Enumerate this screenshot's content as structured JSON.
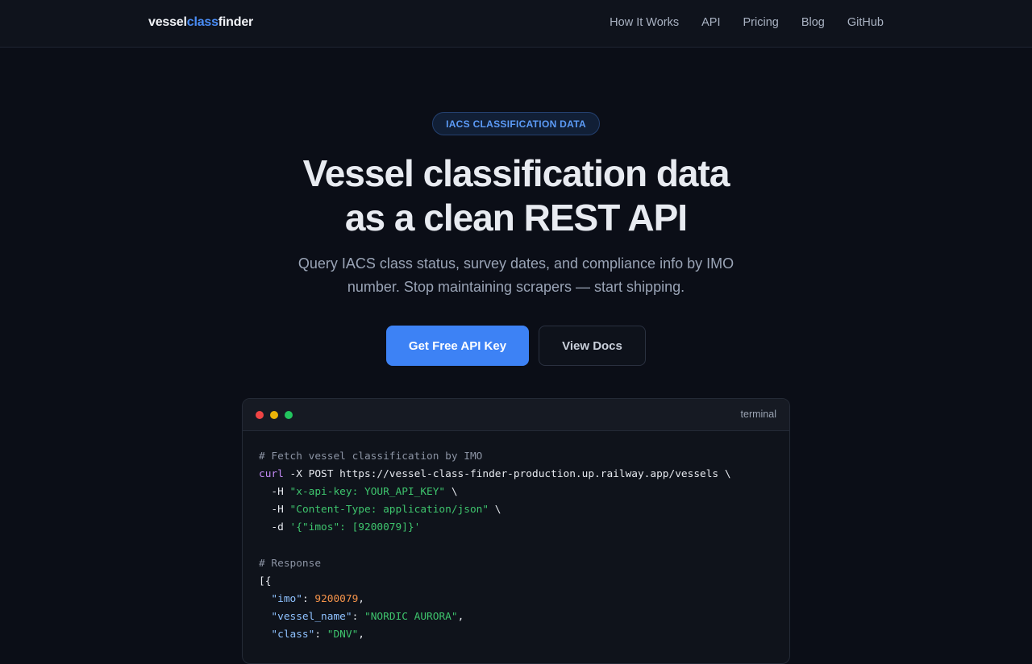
{
  "header": {
    "logo": {
      "part1": "vessel",
      "part2": "class",
      "part3": "finder"
    },
    "nav": [
      "How It Works",
      "API",
      "Pricing",
      "Blog",
      "GitHub"
    ]
  },
  "hero": {
    "badge": "IACS CLASSIFICATION DATA",
    "headline_line1": "Vessel classification data",
    "headline_line2": "as a clean REST API",
    "subtitle_line1": "Query IACS class status, survey dates, and compliance info by IMO",
    "subtitle_line2": "number. Stop maintaining scrapers — start shipping.",
    "primary_button": "Get Free API Key",
    "secondary_button": "View Docs"
  },
  "terminal": {
    "title": "terminal",
    "comment_request": "# Fetch vessel classification by IMO",
    "cmd": "curl",
    "cmd_args": " -X POST https://vessel-class-finder-production.up.railway.app/vessels \\",
    "header1_flag": "  -H ",
    "header1_value": "\"x-api-key: YOUR_API_KEY\"",
    "header1_tail": " \\",
    "header2_flag": "  -H ",
    "header2_value": "\"Content-Type: application/json\"",
    "header2_tail": " \\",
    "data_flag": "  -d ",
    "data_value": "'{\"imos\": [9200079]}'",
    "comment_response": "# Response",
    "open": "[{",
    "imo_key": "  \"imo\"",
    "imo_value": "9200079",
    "name_key": "  \"vessel_name\"",
    "name_value": "\"NORDIC AURORA\"",
    "class_key": "  \"class\"",
    "class_value": "\"DNV\"",
    "colon": ": ",
    "comma": ","
  },
  "colors": {
    "accent": "#3d82f5",
    "background": "#0b0e17"
  }
}
